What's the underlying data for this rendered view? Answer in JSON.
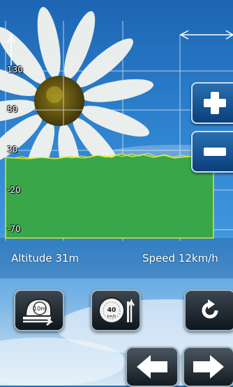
{
  "chart": {
    "y_ticks": [
      "130",
      "80",
      "30",
      "-20",
      "-70"
    ],
    "fill_color": "#3aa64a",
    "outline_color": "#d8e82a"
  },
  "status": {
    "altitude_text": "Altitude 31m",
    "speed_text": "Speed  12km/h"
  },
  "zoom": {
    "in_icon": "plus-icon",
    "out_icon": "minus-icon"
  },
  "toolbar": {
    "distance_badge": "10m",
    "speed_badge": "40",
    "speed_unit": "km/h",
    "distance_icon": "tape-measure-icon",
    "speed_icon": "speedometer-icon",
    "refresh_icon": "refresh-icon"
  },
  "nav": {
    "back_icon": "arrow-left-icon",
    "forward_icon": "arrow-right-icon"
  }
}
